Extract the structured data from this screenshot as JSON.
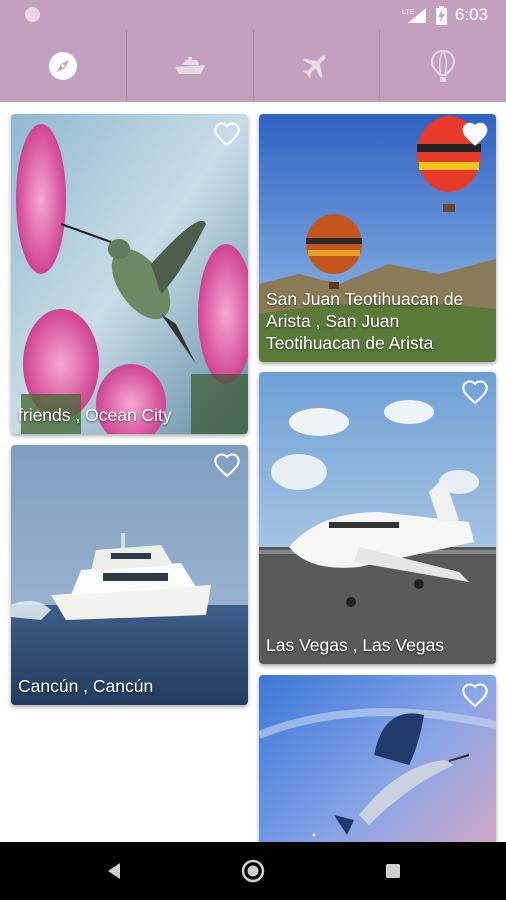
{
  "status_bar": {
    "time": "6:03",
    "network_label": "LTE",
    "icons": [
      "notification-dot-icon",
      "lte-signal-icon",
      "battery-charging-icon"
    ]
  },
  "tabs": [
    {
      "name": "explore",
      "icon": "compass-icon",
      "selected": true
    },
    {
      "name": "cruise",
      "icon": "ship-icon",
      "selected": false
    },
    {
      "name": "flights",
      "icon": "airplane-icon",
      "selected": false
    },
    {
      "name": "balloon",
      "icon": "hot-air-balloon-icon",
      "selected": false
    }
  ],
  "cards": [
    {
      "caption": "friends , Ocean City",
      "image": "hummingbird-and-thistle-flowers",
      "favorite_icon": "heart-outline-icon"
    },
    {
      "caption": "San Juan Teotihuacan de Arista , San Juan Teotihuacan de Arista",
      "image": "hot-air-balloons-over-hills",
      "favorite_icon": "heart-filled-icon"
    },
    {
      "caption": "Cancún , Cancún",
      "image": "white-yacht-on-sea",
      "favorite_icon": "heart-outline-icon"
    },
    {
      "caption": "Las Vegas , Las Vegas",
      "image": "private-jet-on-runway",
      "favorite_icon": "heart-outline-icon"
    },
    {
      "caption": "",
      "image": "sailfish-jumping-at-sunset",
      "favorite_icon": "heart-outline-icon"
    }
  ],
  "nav_bar": {
    "icons": [
      "back-icon",
      "home-icon",
      "recents-icon"
    ]
  },
  "colors": {
    "accent": "#c4a0bf",
    "tab_divider": "#b08aa9",
    "nav_bar": "#000000"
  }
}
